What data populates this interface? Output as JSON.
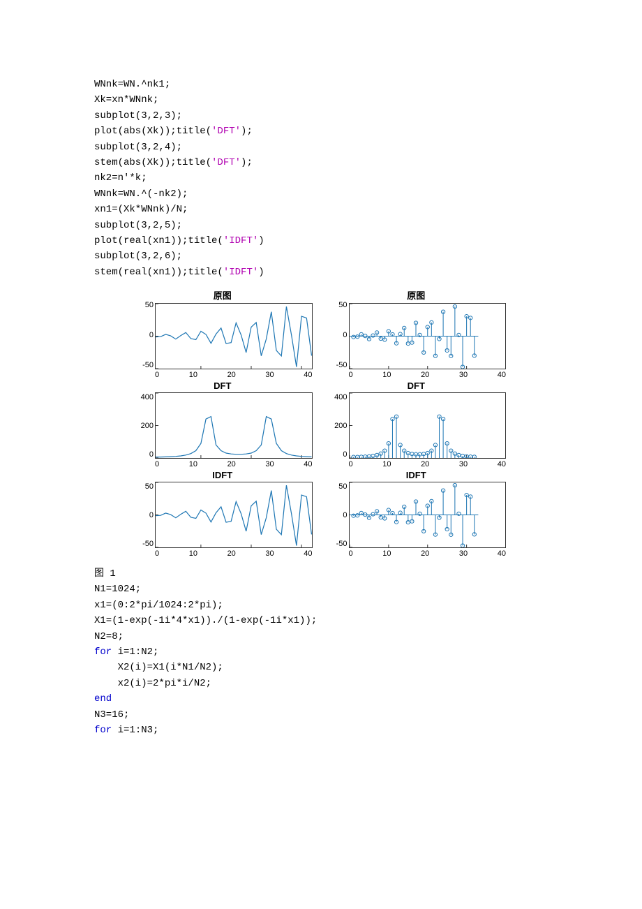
{
  "code_top": [
    {
      "t": "WNnk=WN.^nk1;"
    },
    {
      "t": "Xk=xn*WNnk;"
    },
    {
      "t": "subplot(3,2,3);"
    },
    {
      "t": "plot(abs(Xk));title(",
      "s": "'DFT'",
      "r": ");"
    },
    {
      "t": "subplot(3,2,4);"
    },
    {
      "t": "stem(abs(Xk));title(",
      "s": "'DFT'",
      "r": ");"
    },
    {
      "t": "nk2=n'*k;"
    },
    {
      "t": "WNnk=WN.^(-nk2);"
    },
    {
      "t": "xn1=(Xk*WNnk)/N;"
    },
    {
      "t": "subplot(3,2,5);"
    },
    {
      "t": "plot(real(xn1));title(",
      "s": "'IDFT'",
      "r": ")"
    },
    {
      "t": "subplot(3,2,6);"
    },
    {
      "t": "stem(real(xn1));title(",
      "s": "'IDFT'",
      "r": ")"
    }
  ],
  "fig_label": "图 1",
  "code_bottom": [
    {
      "t": "N1=1024;"
    },
    {
      "t": "x1=(0:2*pi/1024:2*pi);"
    },
    {
      "t": "X1=(1-exp(-1i*4*x1))./(1-exp(-1i*x1));"
    },
    {
      "t": "N2=8;"
    },
    {
      "k": "for",
      "t": " i=1:N2;"
    },
    {
      "t": "    X2(i)=X1(i*N1/N2);"
    },
    {
      "t": "    x2(i)=2*pi*i/N2;"
    },
    {
      "k": "end"
    },
    {
      "t": "N3=16;"
    },
    {
      "k": "for",
      "t": " i=1:N3;"
    }
  ],
  "chart_data": [
    {
      "id": "orig_line",
      "type": "line",
      "title": "原图",
      "yticks": [
        -50,
        0,
        50
      ],
      "xticks": [
        0,
        10,
        20,
        30,
        40
      ],
      "xlim": [
        1,
        32
      ],
      "ylim": [
        -50,
        50
      ],
      "x": [
        1,
        2,
        3,
        4,
        5,
        6,
        7,
        8,
        9,
        10,
        11,
        12,
        13,
        14,
        15,
        16,
        17,
        18,
        19,
        20,
        21,
        22,
        23,
        24,
        25,
        26,
        27,
        28,
        29,
        30,
        31,
        32
      ],
      "y": [
        -1.3,
        -0.8,
        2.8,
        0.4,
        -4.5,
        1.0,
        5.6,
        -3.8,
        -5.4,
        7.5,
        2.7,
        -11.0,
        3.2,
        12.5,
        -11.4,
        -9.9,
        20.5,
        1.8,
        -25.2,
        14.0,
        21.1,
        -30.3,
        -4.3,
        37.5,
        -22.0,
        -30.5,
        45.6,
        1.8,
        -47.3,
        30.6,
        28.1,
        -30.0
      ]
    },
    {
      "id": "orig_stem",
      "type": "stem",
      "title": "原图",
      "yticks": [
        -50,
        0,
        50
      ],
      "xticks": [
        0,
        10,
        20,
        30,
        40
      ],
      "xlim": [
        0,
        40
      ],
      "ylim": [
        -50,
        50
      ],
      "x": [
        1,
        2,
        3,
        4,
        5,
        6,
        7,
        8,
        9,
        10,
        11,
        12,
        13,
        14,
        15,
        16,
        17,
        18,
        19,
        20,
        21,
        22,
        23,
        24,
        25,
        26,
        27,
        28,
        29,
        30,
        31,
        32
      ],
      "y": [
        -1.3,
        -0.8,
        2.8,
        0.4,
        -4.5,
        1.0,
        5.6,
        -3.8,
        -5.4,
        7.5,
        2.7,
        -11.0,
        3.2,
        12.5,
        -11.4,
        -9.9,
        20.5,
        1.8,
        -25.2,
        14.0,
        21.1,
        -30.3,
        -4.3,
        37.5,
        -22.0,
        -30.5,
        45.6,
        1.8,
        -47.3,
        30.6,
        28.1,
        -30.0
      ]
    },
    {
      "id": "dft_line",
      "type": "line",
      "title": "DFT",
      "yticks": [
        0,
        200,
        400
      ],
      "xticks": [
        0,
        10,
        20,
        30,
        40
      ],
      "xlim": [
        1,
        32
      ],
      "ylim": [
        0,
        400
      ],
      "x": [
        1,
        2,
        3,
        4,
        5,
        6,
        7,
        8,
        9,
        10,
        11,
        12,
        13,
        14,
        15,
        16,
        17,
        18,
        19,
        20,
        21,
        22,
        23,
        24,
        25,
        26,
        27,
        28,
        29,
        30,
        31,
        32
      ],
      "y": [
        6,
        6,
        7,
        8,
        10,
        13,
        18,
        27,
        45,
        90,
        240,
        255,
        80,
        45,
        30,
        25,
        23,
        23,
        25,
        30,
        45,
        80,
        255,
        240,
        90,
        45,
        27,
        18,
        13,
        10,
        8,
        7
      ]
    },
    {
      "id": "dft_stem",
      "type": "stem",
      "title": "DFT",
      "yticks": [
        0,
        200,
        400
      ],
      "xticks": [
        0,
        10,
        20,
        30,
        40
      ],
      "xlim": [
        0,
        40
      ],
      "ylim": [
        0,
        400
      ],
      "x": [
        1,
        2,
        3,
        4,
        5,
        6,
        7,
        8,
        9,
        10,
        11,
        12,
        13,
        14,
        15,
        16,
        17,
        18,
        19,
        20,
        21,
        22,
        23,
        24,
        25,
        26,
        27,
        28,
        29,
        30,
        31,
        32
      ],
      "y": [
        6,
        6,
        7,
        8,
        10,
        13,
        18,
        27,
        45,
        90,
        240,
        255,
        80,
        45,
        30,
        25,
        23,
        23,
        25,
        30,
        45,
        80,
        255,
        240,
        90,
        45,
        27,
        18,
        13,
        10,
        8,
        7
      ]
    },
    {
      "id": "idft_line",
      "type": "line",
      "title": "IDFT",
      "yticks": [
        -50,
        0,
        50
      ],
      "xticks": [
        0,
        10,
        20,
        30,
        40
      ],
      "xlim": [
        1,
        32
      ],
      "ylim": [
        -50,
        50
      ],
      "x": [
        1,
        2,
        3,
        4,
        5,
        6,
        7,
        8,
        9,
        10,
        11,
        12,
        13,
        14,
        15,
        16,
        17,
        18,
        19,
        20,
        21,
        22,
        23,
        24,
        25,
        26,
        27,
        28,
        29,
        30,
        31,
        32
      ],
      "y": [
        -1.3,
        -0.8,
        2.8,
        0.4,
        -4.5,
        1.0,
        5.6,
        -3.8,
        -5.4,
        7.5,
        2.7,
        -11.0,
        3.2,
        12.5,
        -11.4,
        -9.9,
        20.5,
        1.8,
        -25.2,
        14.0,
        21.1,
        -30.3,
        -4.3,
        37.5,
        -22.0,
        -30.5,
        45.6,
        1.8,
        -47.3,
        30.6,
        28.1,
        -30.0
      ]
    },
    {
      "id": "idft_stem",
      "type": "stem",
      "title": "IDFT",
      "yticks": [
        -50,
        0,
        50
      ],
      "xticks": [
        0,
        10,
        20,
        30,
        40
      ],
      "xlim": [
        0,
        40
      ],
      "ylim": [
        -50,
        50
      ],
      "x": [
        1,
        2,
        3,
        4,
        5,
        6,
        7,
        8,
        9,
        10,
        11,
        12,
        13,
        14,
        15,
        16,
        17,
        18,
        19,
        20,
        21,
        22,
        23,
        24,
        25,
        26,
        27,
        28,
        29,
        30,
        31,
        32
      ],
      "y": [
        -1.3,
        -0.8,
        2.8,
        0.4,
        -4.5,
        1.0,
        5.6,
        -3.8,
        -5.4,
        7.5,
        2.7,
        -11.0,
        3.2,
        12.5,
        -11.4,
        -9.9,
        20.5,
        1.8,
        -25.2,
        14.0,
        21.1,
        -30.3,
        -4.3,
        37.5,
        -22.0,
        -30.5,
        45.6,
        1.8,
        -47.3,
        30.6,
        28.1,
        -30.0
      ]
    }
  ]
}
